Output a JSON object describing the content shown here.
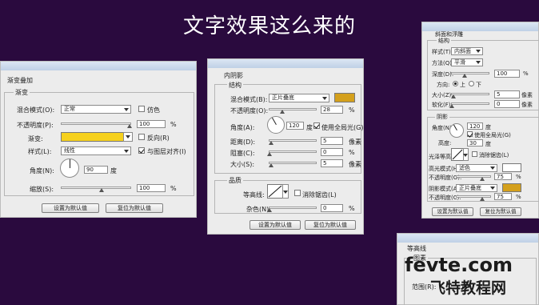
{
  "title": "文字效果这么来的",
  "colors": {
    "background": "#2a0a3e",
    "gold": "#d4a01c",
    "gradient_yellow": "#f6d11d",
    "white": "#ffffff"
  },
  "panel1": {
    "header": "渐变叠加",
    "group": "渐变",
    "blend_label": "混合模式(O):",
    "blend_value": "正常",
    "dither_label": "仿色",
    "opacity_label": "不透明度(P):",
    "opacity_value": "100",
    "opacity_unit": "%",
    "gradient_label": "渐变:",
    "reverse_label": "反向(R)",
    "style_label": "样式(L):",
    "style_value": "线性",
    "align_label": "与图层对齐(I)",
    "angle_label": "角度(N):",
    "angle_value": "90",
    "angle_unit": "度",
    "scale_label": "缩放(S):",
    "scale_value": "100",
    "scale_unit": "%",
    "default_button": "设置为默认值",
    "reset_button": "复位为默认值"
  },
  "panel2": {
    "header": "内阴影",
    "group": "结构",
    "blend_label": "混合模式(B):",
    "blend_value": "正片叠底",
    "opacity_label": "不透明度(O):",
    "opacity_value": "28",
    "opacity_unit": "%",
    "angle_label": "角度(A):",
    "angle_value": "120",
    "angle_unit": "度",
    "global_light_label": "使用全局光(G)",
    "distance_label": "距离(D):",
    "distance_value": "5",
    "distance_unit": "像素",
    "choke_label": "阻塞(C):",
    "choke_value": "0",
    "choke_unit": "%",
    "size_label": "大小(S):",
    "size_value": "5",
    "size_unit": "像素",
    "quality_group": "品质",
    "contour_label": "等高线:",
    "antialias_label": "消除锯齿(L)",
    "noise_label": "杂色(N):",
    "noise_value": "0",
    "noise_unit": "%",
    "default_button": "设置为默认值",
    "reset_button": "复位为默认值"
  },
  "panel3": {
    "header": "斜面和浮雕",
    "group": "结构",
    "style_label": "样式(T):",
    "style_value": "内斜面",
    "technique_label": "方法(Q):",
    "technique_value": "平滑",
    "depth_label": "深度(D):",
    "depth_value": "100",
    "depth_unit": "%",
    "direction_label": "方向:",
    "dir_up": "上",
    "dir_down": "下",
    "size_label": "大小(Z):",
    "size_value": "5",
    "size_unit": "像素",
    "soften_label": "软化(F):",
    "soften_value": "0",
    "soften_unit": "像素",
    "shading_group": "阴影",
    "angle_label": "角度(N):",
    "angle_value": "120",
    "angle_unit": "度",
    "global_light_label": "使用全局光(G)",
    "altitude_label": "高度:",
    "altitude_value": "30",
    "altitude_unit": "度",
    "gloss_label": "光泽等高线:",
    "antialias_label": "消除锯齿(L)",
    "highlight_label": "高光模式(H):",
    "highlight_value": "滤色",
    "hl_opacity_label": "不透明度(O):",
    "hl_opacity_value": "75",
    "hl_opacity_unit": "%",
    "shadow_label": "阴影模式(A):",
    "shadow_value": "正片叠底",
    "sh_opacity_label": "不透明度(C):",
    "sh_opacity_value": "75",
    "sh_opacity_unit": "%",
    "default_button": "设置为默认值",
    "reset_button": "复位为默认值"
  },
  "panel4": {
    "header": "等高线",
    "group": "图素",
    "range_label": "范围(R):"
  },
  "watermark": {
    "line1": "fevte.com",
    "line2": "飞特教程网"
  }
}
